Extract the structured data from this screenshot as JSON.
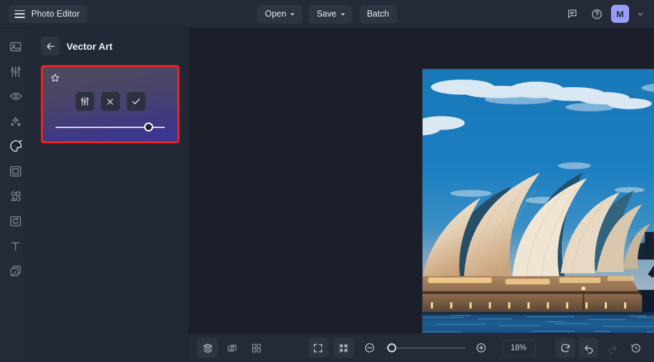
{
  "app": {
    "name": "Photo Editor",
    "menu_icon": "hamburger-icon"
  },
  "topbar": {
    "open_label": "Open",
    "save_label": "Save",
    "batch_label": "Batch",
    "feedback_icon": "comment-icon",
    "help_icon": "help-circle-icon",
    "avatar_initial": "M",
    "avatar_color": "#9a9df7"
  },
  "sidebar": {
    "items": [
      {
        "name": "sidebar-item-image",
        "icon": "image-icon",
        "active": false
      },
      {
        "name": "sidebar-item-adjust",
        "icon": "sliders-icon",
        "active": false
      },
      {
        "name": "sidebar-item-retouch",
        "icon": "eye-icon",
        "active": false
      },
      {
        "name": "sidebar-item-effects",
        "icon": "sparkles-icon",
        "active": false
      },
      {
        "name": "sidebar-item-artistic",
        "icon": "palette-icon",
        "active": true
      },
      {
        "name": "sidebar-item-frames",
        "icon": "frame-icon",
        "active": false
      },
      {
        "name": "sidebar-item-elements",
        "icon": "shapes-icon",
        "active": false
      },
      {
        "name": "sidebar-item-transform",
        "icon": "crop-rotate-icon",
        "active": false
      },
      {
        "name": "sidebar-item-text",
        "icon": "text-icon",
        "active": false
      },
      {
        "name": "sidebar-item-layers",
        "icon": "layers-copy-icon",
        "active": false
      }
    ]
  },
  "panel": {
    "back_icon": "arrow-left-icon",
    "title": "Vector Art",
    "effect_card": {
      "favorite_icon": "star-icon",
      "settings_icon": "sliders-icon",
      "cancel_icon": "close-icon",
      "apply_icon": "check-icon",
      "intensity_percent": 85,
      "highlighted": true,
      "highlight_color": "#f0241c"
    }
  },
  "canvas": {
    "artwork_title": "Sydney Opera House and Harbour Bridge",
    "artwork_style": "vector art"
  },
  "bottombar": {
    "layers_icon": "layers-icon",
    "compare_icon": "compare-icon",
    "grid_icon": "grid-icon",
    "fullscreen_icon": "fullscreen-icon",
    "fit_icon": "fit-to-screen-icon",
    "zoom_out_icon": "minus-circle-icon",
    "zoom_in_icon": "plus-circle-icon",
    "zoom_value": "18%",
    "zoom_slider_percent": 3,
    "reset_icon": "reset-icon",
    "undo_icon": "undo-icon",
    "redo_icon": "redo-icon",
    "history_icon": "history-icon",
    "redo_disabled": true
  }
}
